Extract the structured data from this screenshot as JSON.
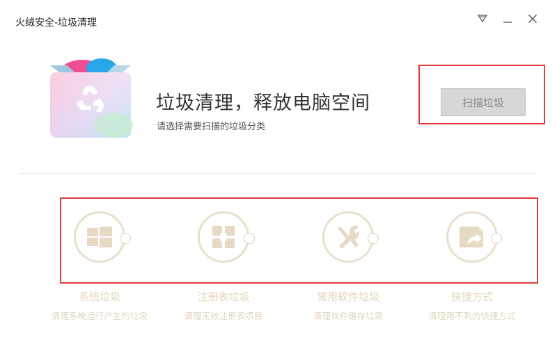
{
  "window": {
    "title": "火绒安全-垃圾清理",
    "controls": [
      "menu-icon",
      "minimize-icon",
      "close-icon"
    ]
  },
  "hero": {
    "headline": "垃圾清理，释放电脑空间",
    "subtitle": "请选择需要扫描的垃圾分类",
    "scan_button_label": "扫描垃圾",
    "scan_button_state": "disabled"
  },
  "categories": [
    {
      "label": "系统垃圾",
      "description": "清理系统运行产生的垃圾",
      "icon": "windows-icon",
      "selected": false
    },
    {
      "label": "注册表垃圾",
      "description": "清理无效注册表项目",
      "icon": "registry-icon",
      "selected": false
    },
    {
      "label": "常用软件垃圾",
      "description": "清理软件缓存垃圾",
      "icon": "tools-icon",
      "selected": false
    },
    {
      "label": "快捷方式",
      "description": "清理用不到的快捷方式",
      "icon": "shortcut-icon",
      "selected": false
    }
  ],
  "colors": {
    "highlight_border": "#e23c3c",
    "category_icon": "#e9dfcc",
    "category_text": "#e2d6bf",
    "scan_button_bg": "#d7d7d7"
  }
}
